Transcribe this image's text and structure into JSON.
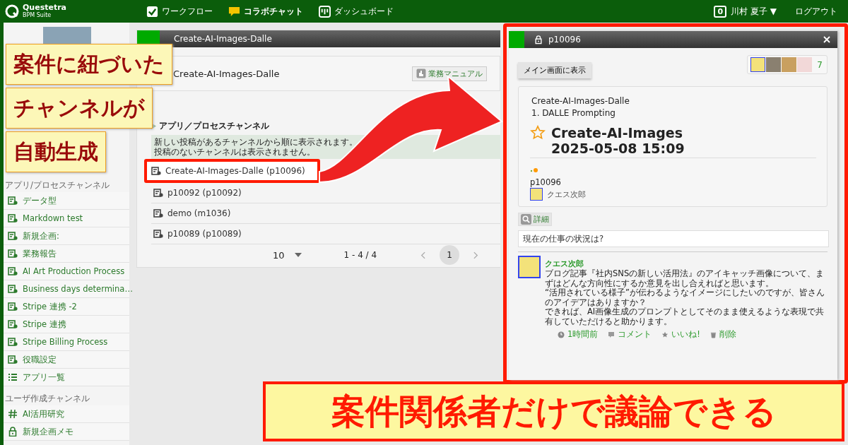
{
  "header": {
    "logo": {
      "name": "Questetra",
      "subtitle": "BPM Suite"
    },
    "nav": [
      {
        "label": "ワークフロー",
        "kind": "workflow",
        "selected": false
      },
      {
        "label": "コラボチャット",
        "kind": "chat",
        "selected": true
      },
      {
        "label": "ダッシュボード",
        "kind": "dashboard",
        "selected": false
      }
    ],
    "notification_count": "0",
    "user": "川村 夏子 ▼",
    "logout": "ログアウト"
  },
  "sidebar": {
    "sections": [
      {
        "title": "アプリ/プロセスチャンネル",
        "items": [
          {
            "label": "データ型",
            "kind": "channel"
          },
          {
            "label": "Markdown test",
            "kind": "channel"
          },
          {
            "label": "新規企画:",
            "kind": "channel"
          },
          {
            "label": "業務報告",
            "kind": "channel"
          },
          {
            "label": "AI Art Production Process",
            "kind": "channel"
          },
          {
            "label": "Business days determina…",
            "kind": "channel"
          },
          {
            "label": "Stripe 連携 -2",
            "kind": "channel"
          },
          {
            "label": "Stripe 連携",
            "kind": "channel"
          },
          {
            "label": "Stripe Billing Process",
            "kind": "channel"
          },
          {
            "label": "役職設定",
            "kind": "channel"
          },
          {
            "label": "アプリ一覧",
            "kind": "list"
          }
        ]
      },
      {
        "title": "ユーザ作成チャンネル",
        "items": [
          {
            "label": "AI活用研究",
            "kind": "hash"
          },
          {
            "label": "新規企画メモ",
            "kind": "lock"
          }
        ]
      }
    ]
  },
  "channel_panel": {
    "title": "Create-AI-Images-Dalle",
    "app_name": "Create-AI-Images-Dalle",
    "manual_button": "業務マニュアル",
    "section_title": "アプリ／プロセスチャンネル",
    "notice": [
      "新しい投稿があるチャンネルから順に表示されます。",
      "投稿のないチャンネルは表示されません。"
    ],
    "channels": [
      {
        "label": "Create-AI-Images-Dalle (p10096)",
        "selected": true
      },
      {
        "label": "p10092 (p10092)",
        "selected": false
      },
      {
        "label": "demo (m1036)",
        "selected": false
      },
      {
        "label": "p10089 (p10089)",
        "selected": false
      }
    ],
    "pagination": {
      "page_size": "10",
      "range": "1 - 4 / 4",
      "pages": [
        {
          "label": "1",
          "selected": true
        }
      ]
    }
  },
  "thread": {
    "title": "p10096",
    "private": true,
    "member_count": "7",
    "show_main_button": "メイン画面に表示",
    "card": {
      "app": "Create-AI-Images-Dalle",
      "step": "1. DALLE Prompting",
      "starred": false,
      "title": "Create-AI-Images",
      "datetime": "2025-05-08 15:09",
      "process_id": "p10096",
      "assignee": "クエス次郎"
    },
    "detail_button": "詳細",
    "post_placeholder": "現在の仕事の状況は?",
    "posts": [
      {
        "author": "クエス次郎",
        "paragraphs": [
          "ブログ記事『社内SNSの新しい活用法』のアイキャッチ画像について、まずはどんな方向性にするか意見を出し合えればと思います。",
          "“活用されている様子”が伝わるようなイメージにしたいのですが、皆さんのアイデアはありますか？",
          "できれば、AI画像生成のプロンプトとしてそのまま使えるような表現で共有していただけると助かります。"
        ],
        "time": "1時間前",
        "comment": "コメント",
        "like": "いいね!",
        "delete": "削除"
      }
    ]
  },
  "callouts": [
    "案件に紐づいた",
    "チャンネルが",
    "自動生成"
  ],
  "banner": "案件関係者だけで議論できる"
}
